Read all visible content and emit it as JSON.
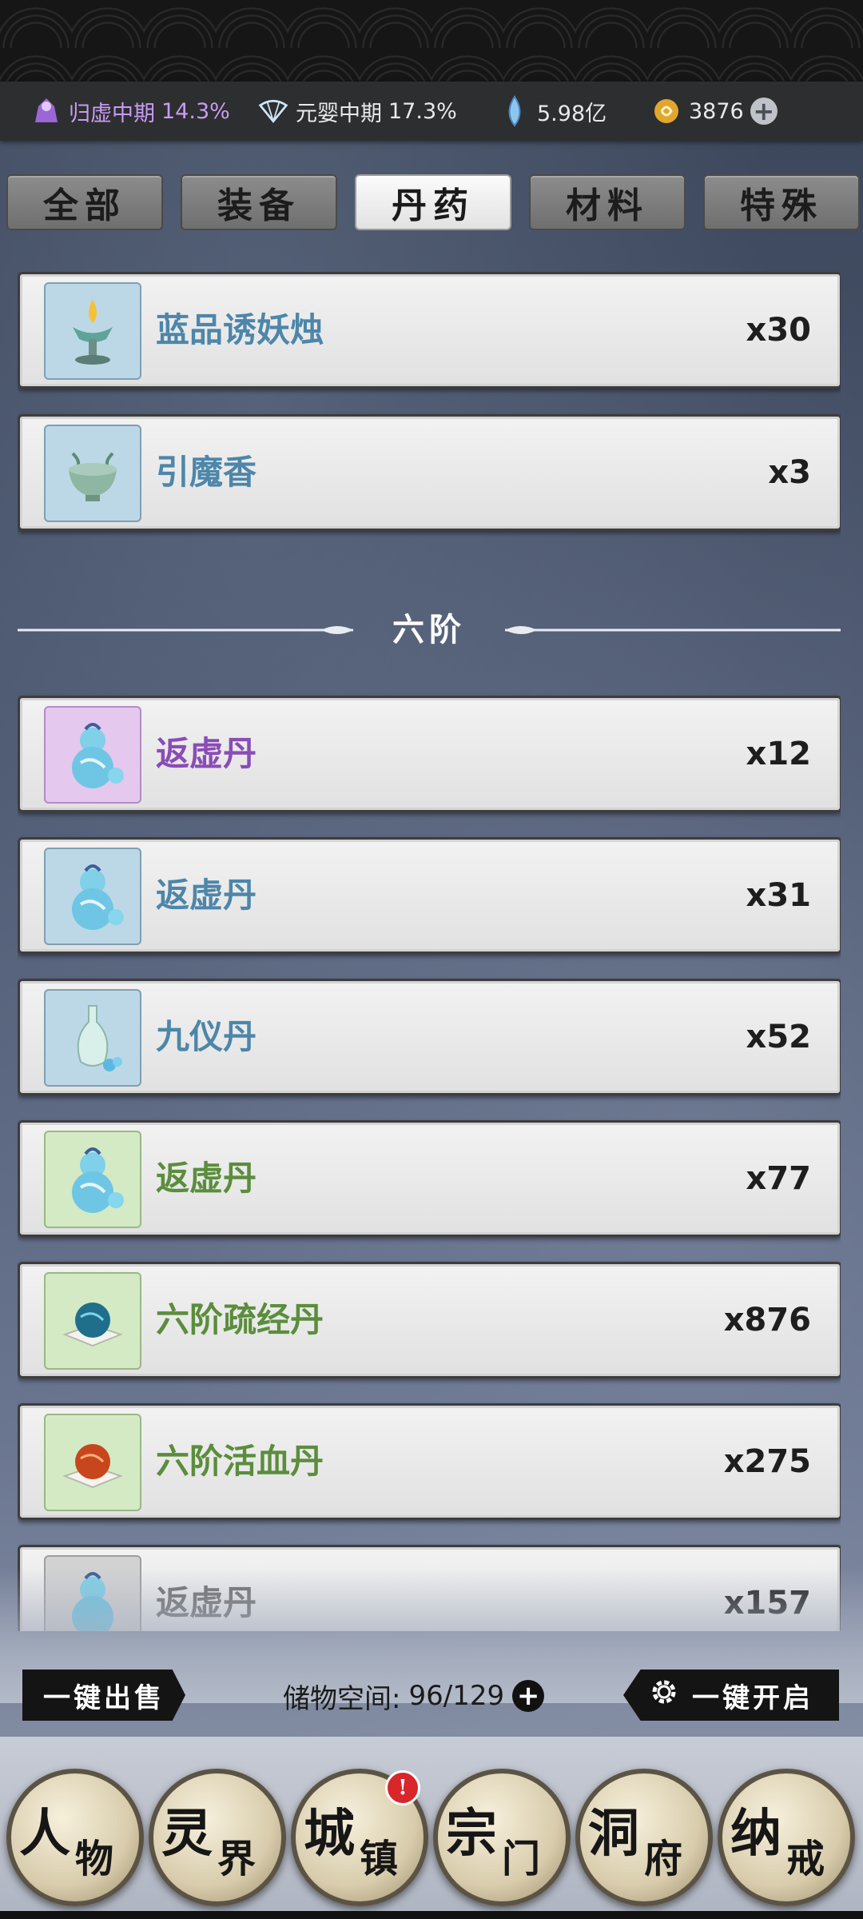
{
  "resources": {
    "realm1": {
      "label": "归虚中期",
      "percent": "14.3%"
    },
    "realm2": {
      "label": "元婴中期",
      "percent": "17.3%"
    },
    "spirit_stones": "5.98亿",
    "gold": "3876"
  },
  "tabs": [
    {
      "label": "全部"
    },
    {
      "label": "装备"
    },
    {
      "label": "丹药"
    },
    {
      "label": "材料"
    },
    {
      "label": "特殊"
    }
  ],
  "active_tab": "丹药",
  "items_top": [
    {
      "name": "蓝品诱妖烛",
      "count": "x30"
    },
    {
      "name": "引魔香",
      "count": "x3"
    }
  ],
  "section_label": "六阶",
  "items": [
    {
      "name": "返虚丹",
      "count": "x12"
    },
    {
      "name": "返虚丹",
      "count": "x31"
    },
    {
      "name": "九仪丹",
      "count": "x52"
    },
    {
      "name": "返虚丹",
      "count": "x77"
    },
    {
      "name": "六阶疏经丹",
      "count": "x876"
    },
    {
      "name": "六阶活血丹",
      "count": "x275"
    },
    {
      "name": "返虚丹",
      "count": "x157"
    }
  ],
  "bottom": {
    "sell_all": "一键出售",
    "storage_label": "储物空间:",
    "storage_value": "96/129",
    "open_all": "一键开启"
  },
  "nav": [
    {
      "main": "人",
      "sub": "物"
    },
    {
      "main": "灵",
      "sub": "界"
    },
    {
      "main": "城",
      "sub": "镇"
    },
    {
      "main": "宗",
      "sub": "门"
    },
    {
      "main": "洞",
      "sub": "府"
    },
    {
      "main": "纳",
      "sub": "戒"
    }
  ],
  "nav_badge": "!",
  "colors": {
    "quality_blue": "#4d86a9",
    "quality_purple": "#8a4cb7",
    "quality_green": "#5b8d3c",
    "realm_purple": "#c79bf2"
  }
}
